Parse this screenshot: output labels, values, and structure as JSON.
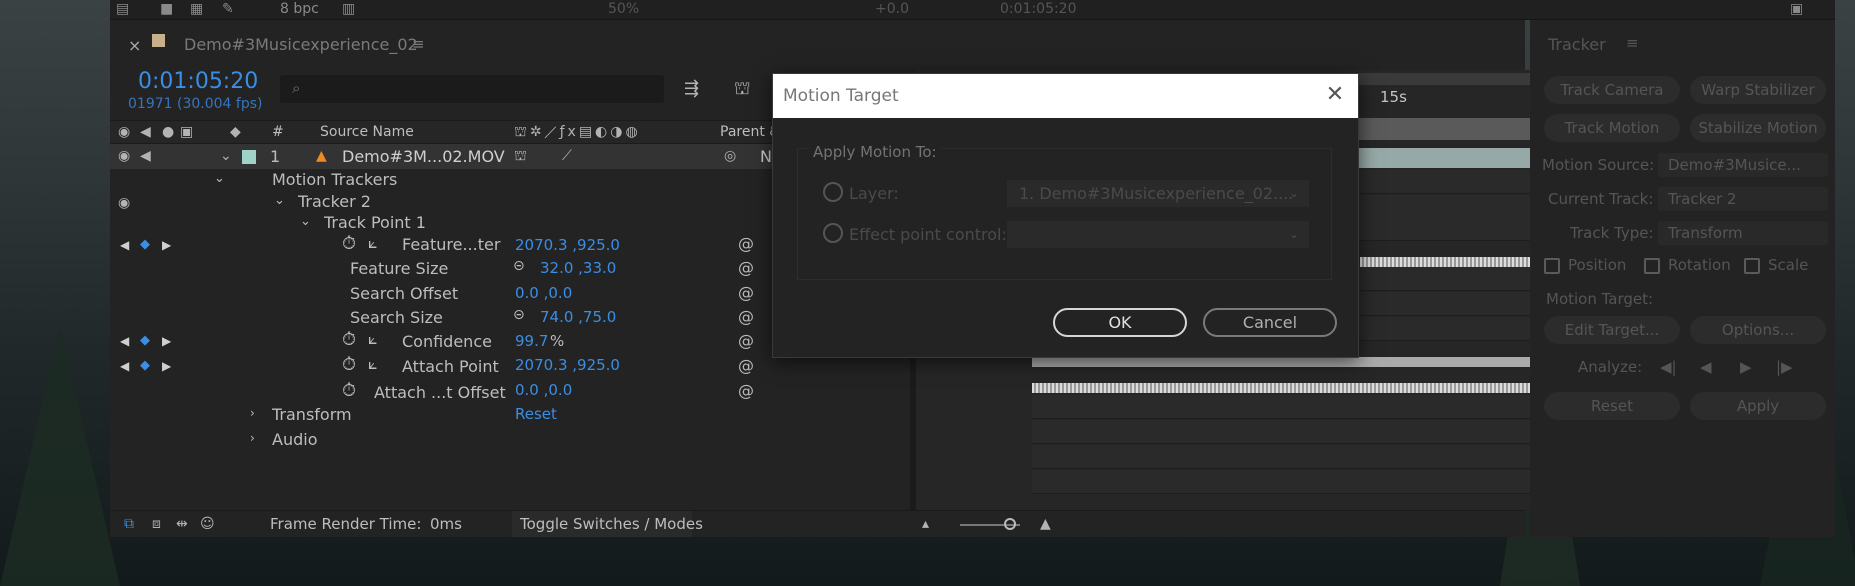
{
  "top_bar": {
    "bpc": "8 bpc",
    "zoom": "50%",
    "exposure": "+0.0",
    "timecode": "0:01:05:20"
  },
  "comp": {
    "tab_title": "Demo#3Musicexperience_02",
    "timecode": "0:01:05:20",
    "frame_info": "01971 (30.004 fps)",
    "columns": {
      "num": "#",
      "source_name": "Source Name",
      "parent": "Parent &"
    },
    "ruler": {
      "mark": "15s"
    },
    "layer": {
      "index": "1",
      "name": "Demo#3M...02.MOV",
      "parent_value": "N"
    },
    "tree": {
      "motion_trackers": "Motion Trackers",
      "tracker": "Tracker 2",
      "track_point": "Track Point 1",
      "transform": "Transform",
      "transform_value": "Reset",
      "audio": "Audio"
    },
    "props": [
      {
        "label": "Feature...ter",
        "value": "2070.3 ,925.0"
      },
      {
        "label": "Feature Size",
        "value": "32.0 ,33.0"
      },
      {
        "label": "Search Offset",
        "value": "0.0 ,0.0"
      },
      {
        "label": "Search Size",
        "value": "74.0 ,75.0"
      },
      {
        "label": "Confidence",
        "value": "99.7",
        "unit": "%"
      },
      {
        "label": "Attach Point",
        "value": "2070.3 ,925.0"
      },
      {
        "label": "Attach ...t Offset",
        "value": "0.0 ,0.0"
      }
    ],
    "footer": {
      "render_label": "Frame Render Time:",
      "render_value": "0ms",
      "toggle": "Toggle Switches / Modes"
    }
  },
  "tracker": {
    "title": "Tracker",
    "buttons": {
      "track_camera": "Track Camera",
      "warp_stabilizer": "Warp Stabilizer",
      "track_motion": "Track Motion",
      "stabilize_motion": "Stabilize Motion"
    },
    "motion_source_label": "Motion Source:",
    "motion_source_value": "Demo#3Musice...",
    "current_track_label": "Current Track:",
    "current_track_value": "Tracker 2",
    "track_type_label": "Track Type:",
    "track_type_value": "Transform",
    "position": "Position",
    "rotation": "Rotation",
    "scale": "Scale",
    "motion_target_label": "Motion Target:",
    "edit_target": "Edit Target...",
    "options": "Options...",
    "analyze_label": "Analyze:",
    "reset": "Reset",
    "apply": "Apply"
  },
  "dialog": {
    "title": "Motion Target",
    "group_label": "Apply Motion To:",
    "layer_label": "Layer:",
    "layer_value": "1. Demo#3Musicexperience_02....",
    "effect_label": "Effect point control:",
    "effect_value": "",
    "ok": "OK",
    "cancel": "Cancel"
  },
  "colors": {
    "accent": "#3a8ee6",
    "panel": "#232323",
    "layer_swatch": "#9fd3c7",
    "label_tan": "#c8b08a"
  }
}
